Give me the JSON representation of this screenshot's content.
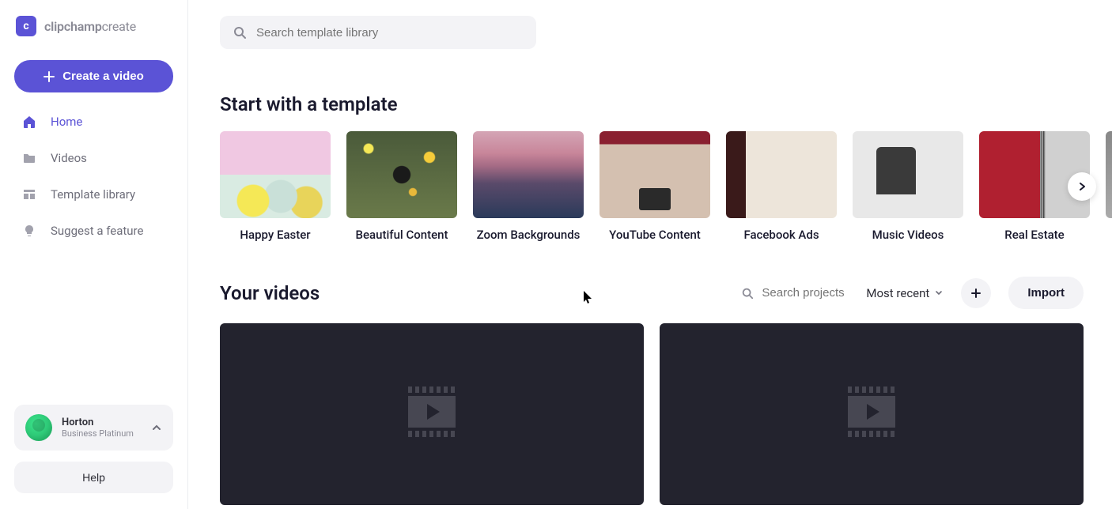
{
  "brand": {
    "logo_letter": "c",
    "name1": "clipchamp",
    "name2": "create"
  },
  "sidebar": {
    "create_label": "Create a video",
    "nav": [
      {
        "label": "Home",
        "icon": "home-icon",
        "active": true
      },
      {
        "label": "Videos",
        "icon": "folder-icon",
        "active": false
      },
      {
        "label": "Template library",
        "icon": "templates-icon",
        "active": false
      },
      {
        "label": "Suggest a feature",
        "icon": "lightbulb-icon",
        "active": false
      }
    ],
    "user": {
      "name": "Horton",
      "plan": "Business Platinum"
    },
    "help_label": "Help"
  },
  "search": {
    "placeholder": "Search template library"
  },
  "templates": {
    "title": "Start with a template",
    "items": [
      {
        "label": "Happy Easter"
      },
      {
        "label": "Beautiful Content"
      },
      {
        "label": "Zoom Backgrounds"
      },
      {
        "label": "YouTube Content"
      },
      {
        "label": "Facebook Ads"
      },
      {
        "label": "Music Videos"
      },
      {
        "label": "Real Estate"
      }
    ]
  },
  "videos": {
    "title": "Your videos",
    "search_placeholder": "Search projects",
    "sort_label": "Most recent",
    "import_label": "Import",
    "items": [
      {},
      {}
    ]
  },
  "colors": {
    "accent": "#5b53d6"
  }
}
